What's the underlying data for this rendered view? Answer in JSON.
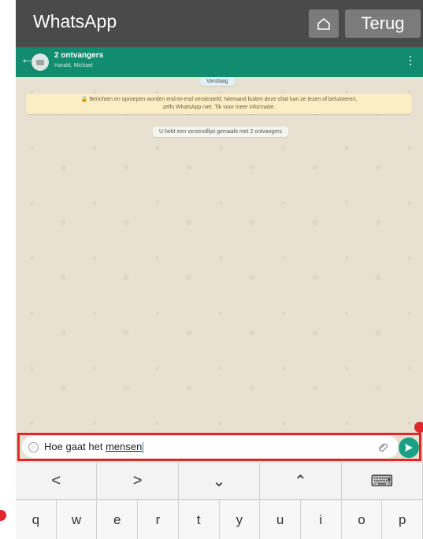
{
  "topbar": {
    "app_title": "WhatsApp",
    "back_label": "Terug"
  },
  "chat_header": {
    "name": "2 ontvangers",
    "members": "Harald, Michael"
  },
  "messages": {
    "date": "Vandaag",
    "encryption_line1": "🔒 Berichten en oproepen worden end-to-end versleuteld. Niemand buiten deze chat kan ze lezen of beluisteren,",
    "encryption_line2": "zelfs WhatsApp niet. Tik voor meer informatie.",
    "broadcast_info": "U hebt een verzendlijst gemaakt met 2 ontvangers"
  },
  "composer": {
    "text_prefix": "Hoe gaat het ",
    "text_underlined": "mensen"
  },
  "keyboard": {
    "nav_keys": [
      "<",
      ">",
      "⌄",
      "⌃",
      "⌨"
    ],
    "letter_keys": [
      "q",
      "w",
      "e",
      "r",
      "t",
      "y",
      "u",
      "i",
      "o",
      "p"
    ]
  },
  "colors": {
    "topbar": "#4a4a4a",
    "header": "#128c6f",
    "send": "#1ba083",
    "highlight": "#e3262c"
  }
}
